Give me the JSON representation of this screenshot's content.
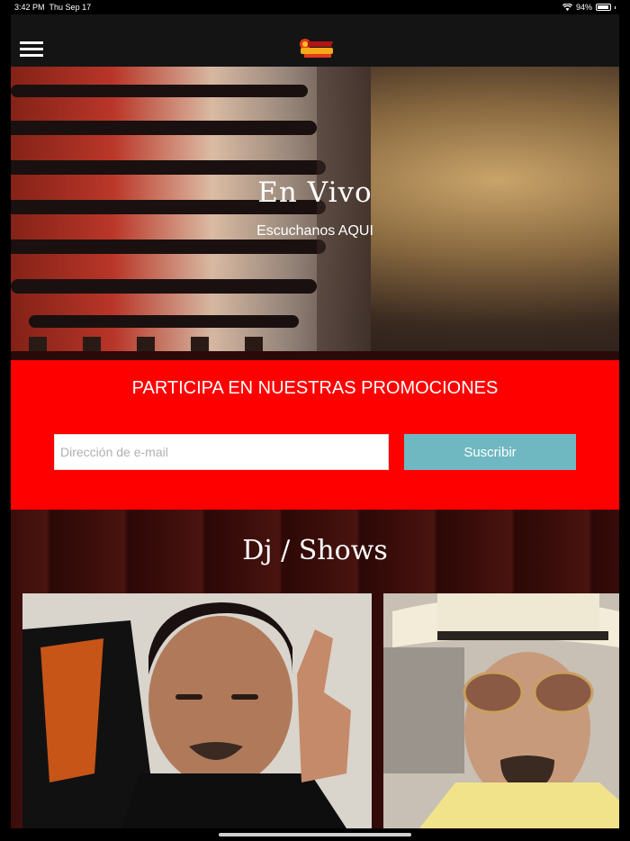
{
  "status_bar": {
    "time": "3:42 PM",
    "date": "Thu Sep 17",
    "battery": "94%",
    "icons": [
      "wifi-icon",
      "battery-icon"
    ]
  },
  "header": {
    "menu_icon": "hamburger-menu-icon",
    "logo": "la-patrona-logo"
  },
  "hero": {
    "title": "En Vivo",
    "subtitle": "Escuchanos AQUI"
  },
  "promo": {
    "title": "PARTICIPA EN NUESTRAS PROMOCIONES",
    "email_placeholder": "Dirección de e-mail",
    "email_value": "",
    "subscribe_label": "Suscribir",
    "colors": {
      "background": "#fe0000",
      "button": "#6fb8c1"
    }
  },
  "dj_section": {
    "title": "Dj / Shows",
    "cards": [
      {
        "image": "dj-photo-1"
      },
      {
        "image": "dj-photo-2"
      }
    ]
  }
}
